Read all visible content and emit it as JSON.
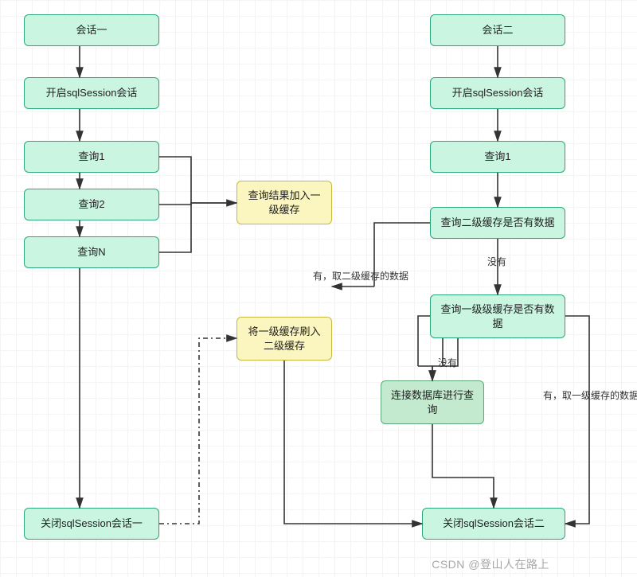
{
  "nodes": {
    "a1": "会话一",
    "a2": "开启sqlSession会话",
    "a3": "查询1",
    "a4": "查询2",
    "a5": "查询N",
    "a6": "关闭sqlSession会话一",
    "y1": "查询结果加入一级缓存",
    "y2": "将一级缓存刷入二级缓存",
    "b1": "会话二",
    "b2": "开启sqlSession会话",
    "b3": "查询1",
    "b4": "查询二级缓存是否有数据",
    "b5": "查询一级级缓存是否有数据",
    "b6": "连接数据库进行查询",
    "b7": "关闭sqlSession会话二"
  },
  "labels": {
    "l1": "有，取二级缓存的数据",
    "l2": "没有",
    "l3": "没有",
    "l4": "有，取一级缓存的数据"
  },
  "watermark": "CSDN @登山人在路上"
}
